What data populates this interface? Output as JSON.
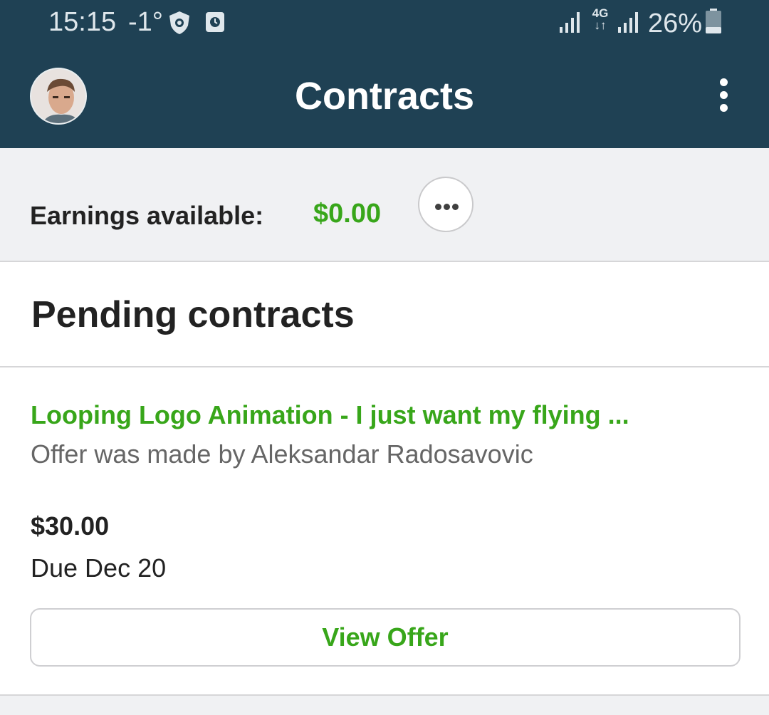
{
  "status_bar": {
    "time": "15:15",
    "temperature": "-1°",
    "network": "4G",
    "battery": "26%"
  },
  "header": {
    "title": "Contracts"
  },
  "earnings": {
    "label": "Earnings available:",
    "value": "$0.00"
  },
  "pending": {
    "section_title": "Pending contracts",
    "contracts": [
      {
        "title": "Looping Logo Animation - I just want my flying ...",
        "offer_by": "Offer was made by Aleksandar Radosavovic",
        "price": "$30.00",
        "due": "Due Dec 20",
        "button_label": "View Offer"
      }
    ]
  },
  "colors": {
    "header_bg": "#1f4154",
    "accent_green": "#38a61a",
    "page_bg": "#f0f1f3"
  }
}
